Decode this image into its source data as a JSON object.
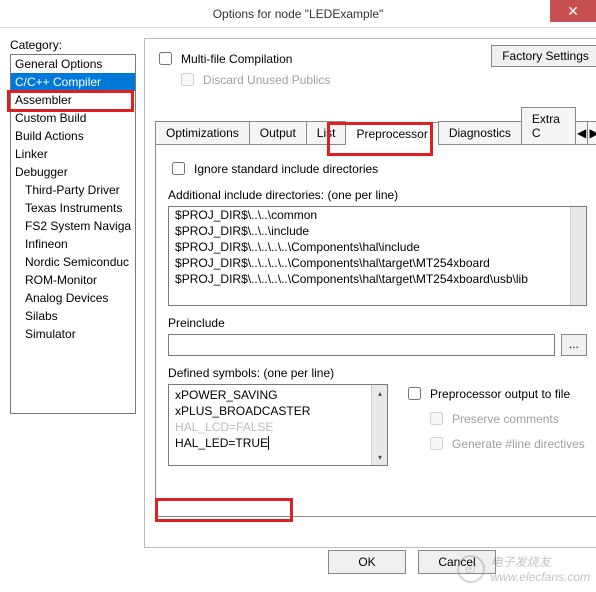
{
  "window": {
    "title": "Options for node \"LEDExample\"",
    "close": "✕"
  },
  "category": {
    "label": "Category:",
    "items": [
      "General Options",
      "C/C++ Compiler",
      "Assembler",
      "Custom Build",
      "Build Actions",
      "Linker",
      "Debugger",
      "Third-Party Driver",
      "Texas Instruments",
      "FS2 System Naviga",
      "Infineon",
      "Nordic Semiconduc",
      "ROM-Monitor",
      "Analog Devices",
      "Silabs",
      "Simulator"
    ],
    "selected_index": 1
  },
  "main": {
    "factory_settings": "Factory Settings",
    "multifile_compilation": "Multi-file Compilation",
    "discard_unused": "Discard Unused Publics",
    "tabs": {
      "items": [
        "Optimizations",
        "Output",
        "List",
        "Preprocessor",
        "Diagnostics",
        "Extra C"
      ],
      "arrow_left": "◀",
      "arrow_right": "▶",
      "active_index": 3
    },
    "ignore_std": "Ignore standard include directories",
    "add_dirs_label": "Additional include directories: (one per line)",
    "add_dirs": [
      "$PROJ_DIR$\\..\\..\\common",
      "$PROJ_DIR$\\..\\..\\include",
      "$PROJ_DIR$\\..\\..\\..\\..\\Components\\hal\\include",
      "$PROJ_DIR$\\..\\..\\..\\..\\Components\\hal\\target\\MT254xboard",
      "$PROJ_DIR$\\..\\..\\..\\..\\Components\\hal\\target\\MT254xboard\\usb\\lib"
    ],
    "preinclude_label": "Preinclude",
    "preinclude_value": "",
    "browse": "...",
    "defsym_label": "Defined symbols: (one per line)",
    "defsym": [
      "xPOWER_SAVING",
      "xPLUS_BROADCASTER",
      "HAL_LCD=FALSE",
      "HAL_LED=TRUE"
    ],
    "ppout": "Preprocessor output to file",
    "preserve": "Preserve comments",
    "genline": "Generate #line directives"
  },
  "buttons": {
    "ok": "OK",
    "cancel": "Cancel"
  },
  "watermark": {
    "site": "电子发烧友",
    "url": "www.elecfans.com"
  }
}
